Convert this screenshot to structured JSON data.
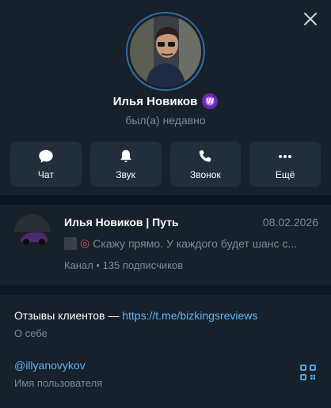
{
  "profile": {
    "name": "Илья Новиков",
    "badge": "W",
    "status": "был(а) недавно"
  },
  "actions": [
    {
      "label": "Чат",
      "icon": "chat-icon"
    },
    {
      "label": "Звук",
      "icon": "bell-icon"
    },
    {
      "label": "Звонок",
      "icon": "phone-icon"
    },
    {
      "label": "Ещё",
      "icon": "more-icon"
    }
  ],
  "channel": {
    "name": "Илья Новиков | Путь",
    "date": "08.02.2026",
    "message": "Скажу прямо. У каждого будет шанс с...",
    "meta": "Канал • 135 подписчиков"
  },
  "about": {
    "prefix": "Отзывы клиентов — ",
    "link": "https://t.me/bizkingsreviews",
    "label": "О себе"
  },
  "username": {
    "value": "@illyanovykov",
    "label": "Имя пользователя"
  },
  "colors": {
    "background": "#17212b",
    "card": "#232e3c",
    "accent": "#5eb5f7",
    "muted": "#7c8b99"
  }
}
